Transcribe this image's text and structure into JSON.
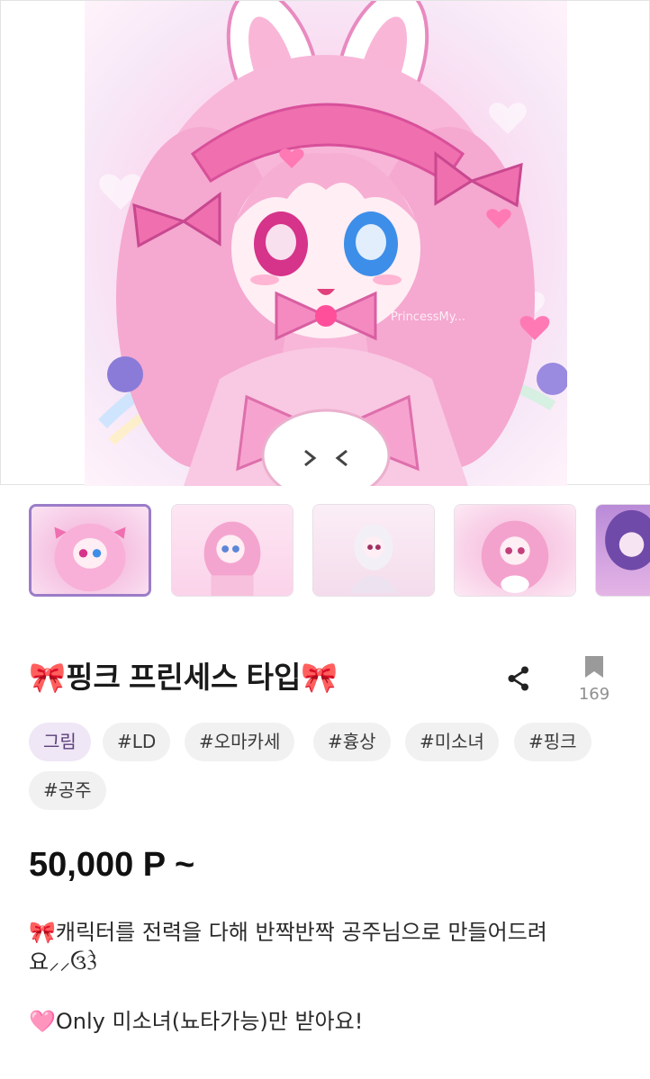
{
  "product": {
    "title": "🎀핑크 프린세스 타입🎀",
    "bookmark_count": "169",
    "price": "50,000 P ~",
    "image_watermark": "PrincessMy..."
  },
  "tags": [
    {
      "label": "그림",
      "type": "category"
    },
    {
      "label": "#LD",
      "type": "hashtag"
    },
    {
      "label": "#오마카세",
      "type": "hashtag"
    },
    {
      "label": "#흉상",
      "type": "hashtag"
    },
    {
      "label": "#미소녀",
      "type": "hashtag"
    },
    {
      "label": "#핑크",
      "type": "hashtag"
    },
    {
      "label": "#공주",
      "type": "hashtag"
    }
  ],
  "description": {
    "line1": "🎀캐릭터를 전력을 다해 반짝반짝 공주님으로 만들어드려",
    "line2": "요⸝⸝ઉ3ે",
    "line3": "",
    "line4": "🩷Only 미소녀(뇨타가능)만 받아요!"
  },
  "thumbnails": [
    {
      "name": "thumb-1",
      "selected": true
    },
    {
      "name": "thumb-2",
      "selected": false
    },
    {
      "name": "thumb-3",
      "selected": false
    },
    {
      "name": "thumb-4",
      "selected": false
    },
    {
      "name": "thumb-5",
      "selected": false
    }
  ],
  "icons": {
    "share": "share-icon",
    "bookmark": "bookmark-icon"
  },
  "colors": {
    "accent": "#9b7cc8",
    "tag_category_bg": "#efe6f6",
    "tag_bg": "#f1f1f1",
    "art_pink": "#f7b8d8"
  }
}
